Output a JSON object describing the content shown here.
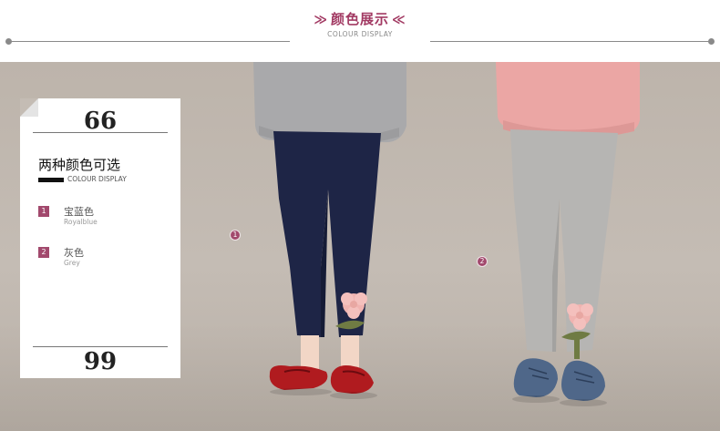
{
  "header": {
    "title": "颜色展示",
    "left_glyph": "≫",
    "right_glyph": "≪",
    "subtitle": "COLOUR DISPLAY"
  },
  "card": {
    "open_quote": "66",
    "heading": "两种颜色可选",
    "heading_en": "COLOUR DISPLAY",
    "close_quote": "99",
    "colors": [
      {
        "num": "1",
        "name_cn": "宝蓝色",
        "name_en": "Royalblue",
        "swatch": "#1f2547"
      },
      {
        "num": "2",
        "name_cn": "灰色",
        "name_en": "Grey",
        "swatch": "#b8b6b4"
      }
    ]
  },
  "markers": [
    "1",
    "2"
  ],
  "colors": {
    "accent": "#a2496d",
    "title": "#a23a63",
    "background": "#c2bab1"
  }
}
